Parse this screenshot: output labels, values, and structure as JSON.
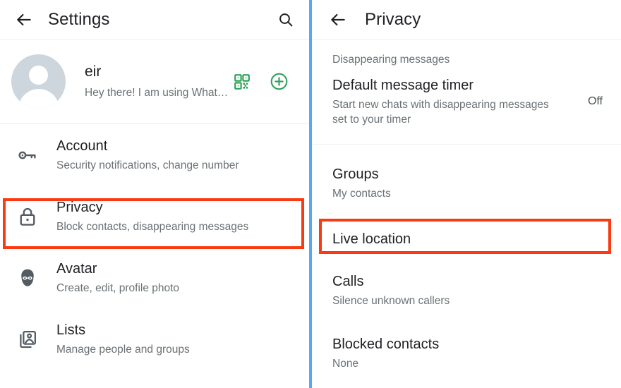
{
  "colors": {
    "accent_green": "#31a35a",
    "highlight_red": "#f93a12",
    "panel_divider_blue": "#54a9f5",
    "title_text": "#1f2024",
    "secondary_text": "#6a7175",
    "avatar_bg": "#ced6dd"
  },
  "left_panel": {
    "appbar": {
      "back_icon": "arrow-left-icon",
      "title": "Settings",
      "search_icon": "search-icon"
    },
    "profile": {
      "avatar_icon": "person-avatar-placeholder",
      "name": "eir",
      "status": "Hey there! I am using What…",
      "qr_icon": "qr-code-icon",
      "add_icon": "plus-circle-icon"
    },
    "items": [
      {
        "icon": "key-icon",
        "title": "Account",
        "subtitle": "Security notifications, change number",
        "highlighted": false
      },
      {
        "icon": "lock-icon",
        "title": "Privacy",
        "subtitle": "Block contacts, disappearing messages",
        "highlighted": true
      },
      {
        "icon": "avatar-face-icon",
        "title": "Avatar",
        "subtitle": "Create, edit, profile photo",
        "highlighted": false
      },
      {
        "icon": "lists-photo-icon",
        "title": "Lists",
        "subtitle": "Manage people and groups",
        "highlighted": false
      }
    ]
  },
  "right_panel": {
    "appbar": {
      "back_icon": "arrow-left-icon",
      "title": "Privacy"
    },
    "section_label": "Disappearing messages",
    "items": [
      {
        "title": "Default message timer",
        "subtitle": "Start new chats with disappearing messages set to your timer",
        "value": "Off",
        "highlighted": false
      },
      {
        "title": "Groups",
        "subtitle": "My contacts",
        "value": "",
        "highlighted": false
      },
      {
        "title": "Live location",
        "subtitle": "",
        "value": "",
        "highlighted": true
      },
      {
        "title": "Calls",
        "subtitle": "Silence unknown callers",
        "value": "",
        "highlighted": false
      },
      {
        "title": "Blocked contacts",
        "subtitle": "None",
        "value": "",
        "highlighted": false
      }
    ]
  }
}
